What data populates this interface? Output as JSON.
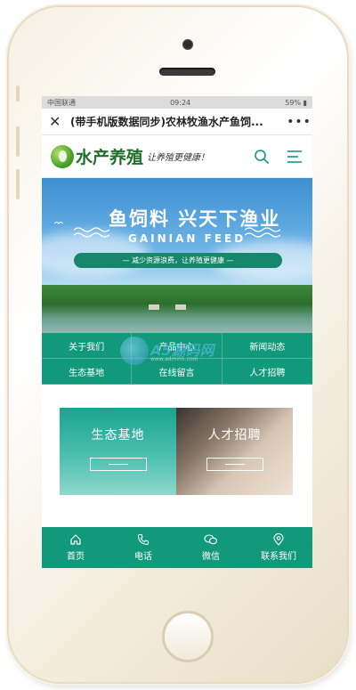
{
  "status_bar": {
    "carrier": "中国联通",
    "time": "09:24",
    "indicators": "59% ▮"
  },
  "browser": {
    "close_icon": "close-icon",
    "page_title": "(带手机版数据同步)农林牧渔水产鱼饲...",
    "more_icon": "more-dots-icon"
  },
  "site_header": {
    "logo_text": "水产养殖",
    "slogan": "让养殖更健康！",
    "search_icon": "search-icon",
    "menu_icon": "menu-icon"
  },
  "banner": {
    "headline": "鱼饲料 兴天下渔业",
    "subline": "GAINIAN FEED",
    "ribbon": "— 减少资源浪费，让养殖更健康 —"
  },
  "nav": [
    {
      "label": "关于我们"
    },
    {
      "label": "产品中心"
    },
    {
      "label": "新闻动态"
    },
    {
      "label": "生态基地"
    },
    {
      "label": "在线留言"
    },
    {
      "label": "人才招聘"
    }
  ],
  "cards": [
    {
      "label": "生态基地"
    },
    {
      "label": "人才招聘"
    }
  ],
  "watermark": {
    "text": "A5源码网",
    "url": "www.admin5.com"
  },
  "tabbar": [
    {
      "label": "首页",
      "icon": "home-icon"
    },
    {
      "label": "电话",
      "icon": "phone-icon"
    },
    {
      "label": "微信",
      "icon": "wechat-icon"
    },
    {
      "label": "联系我们",
      "icon": "location-icon"
    }
  ],
  "colors": {
    "primary": "#12987a",
    "logo_green": "#1f6e2a",
    "sky": "#3c8fd0"
  }
}
